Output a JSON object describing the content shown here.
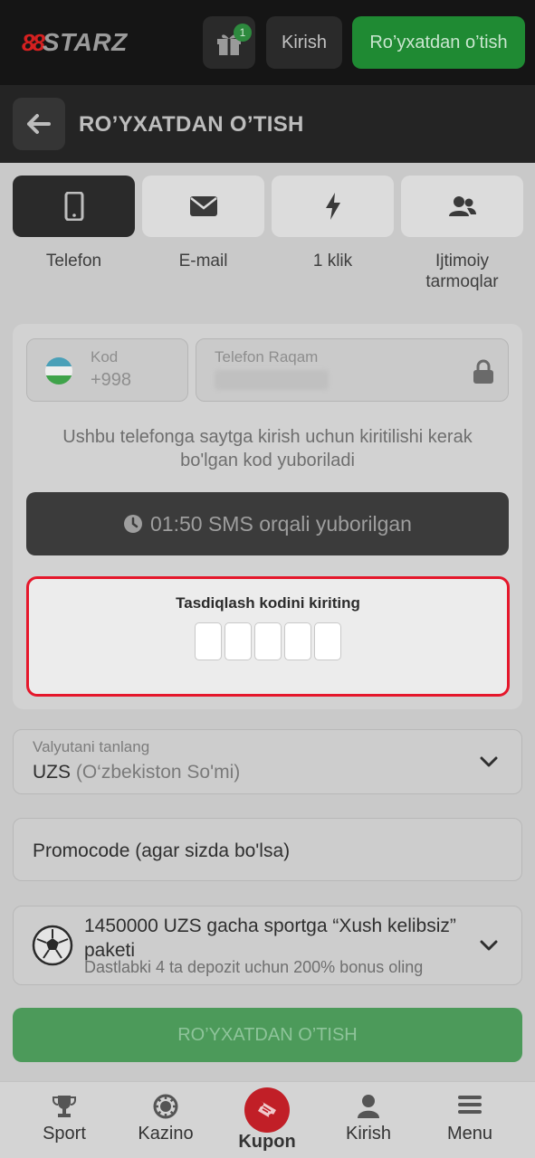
{
  "header": {
    "logo_mark": "88",
    "logo_word": "STARZ",
    "gift_count": "1",
    "login_label": "Kirish",
    "register_label": "Ro’yxatdan o’tish"
  },
  "titlebar": {
    "title": "RO’YXATDAN O’TISH"
  },
  "tabs": [
    {
      "label": "Telefon",
      "icon": "phone-icon",
      "active": true
    },
    {
      "label": "E-mail",
      "icon": "envelope-icon",
      "active": false
    },
    {
      "label": "1 klik",
      "icon": "lightning-icon",
      "active": false
    },
    {
      "label": "Ijtimoiy tarmoqlar",
      "icon": "users-icon",
      "active": false
    }
  ],
  "phone_form": {
    "code_label": "Kod",
    "code_value": "+998",
    "phone_label": "Telefon Raqam",
    "info_text": "Ushbu telefonga saytga kirish uchun kiritilishi kerak bo'lgan kod yuboriladi",
    "sms_timer": "01:50",
    "sms_text": "SMS orqali yuborilgan",
    "verify_title": "Tasdiqlash kodini kiriting",
    "code_digits": 5
  },
  "currency": {
    "label": "Valyutani tanlang",
    "code": "UZS",
    "name": "(O‘zbekiston So'mi)"
  },
  "promo": {
    "placeholder": "Promocode (agar sizda bo'lsa)"
  },
  "bonus": {
    "title": "1450000 UZS gacha sportga “Xush kelibsiz” paketi",
    "subtitle": "Dastlabki 4 ta depozit uchun 200% bonus oling"
  },
  "submit_label": "RO’YXATDAN O’TISH",
  "bottom_nav": [
    {
      "label": "Sport",
      "icon": "trophy-icon"
    },
    {
      "label": "Kazino",
      "icon": "casino-chip-icon"
    },
    {
      "label": "Kupon",
      "icon": "ticket-icon",
      "active": true
    },
    {
      "label": "Kirish",
      "icon": "user-icon"
    },
    {
      "label": "Menu",
      "icon": "hamburger-icon"
    }
  ],
  "colors": {
    "accent_green": "#1f8a33",
    "accent_red": "#e5172b",
    "header_bg": "#151515"
  }
}
